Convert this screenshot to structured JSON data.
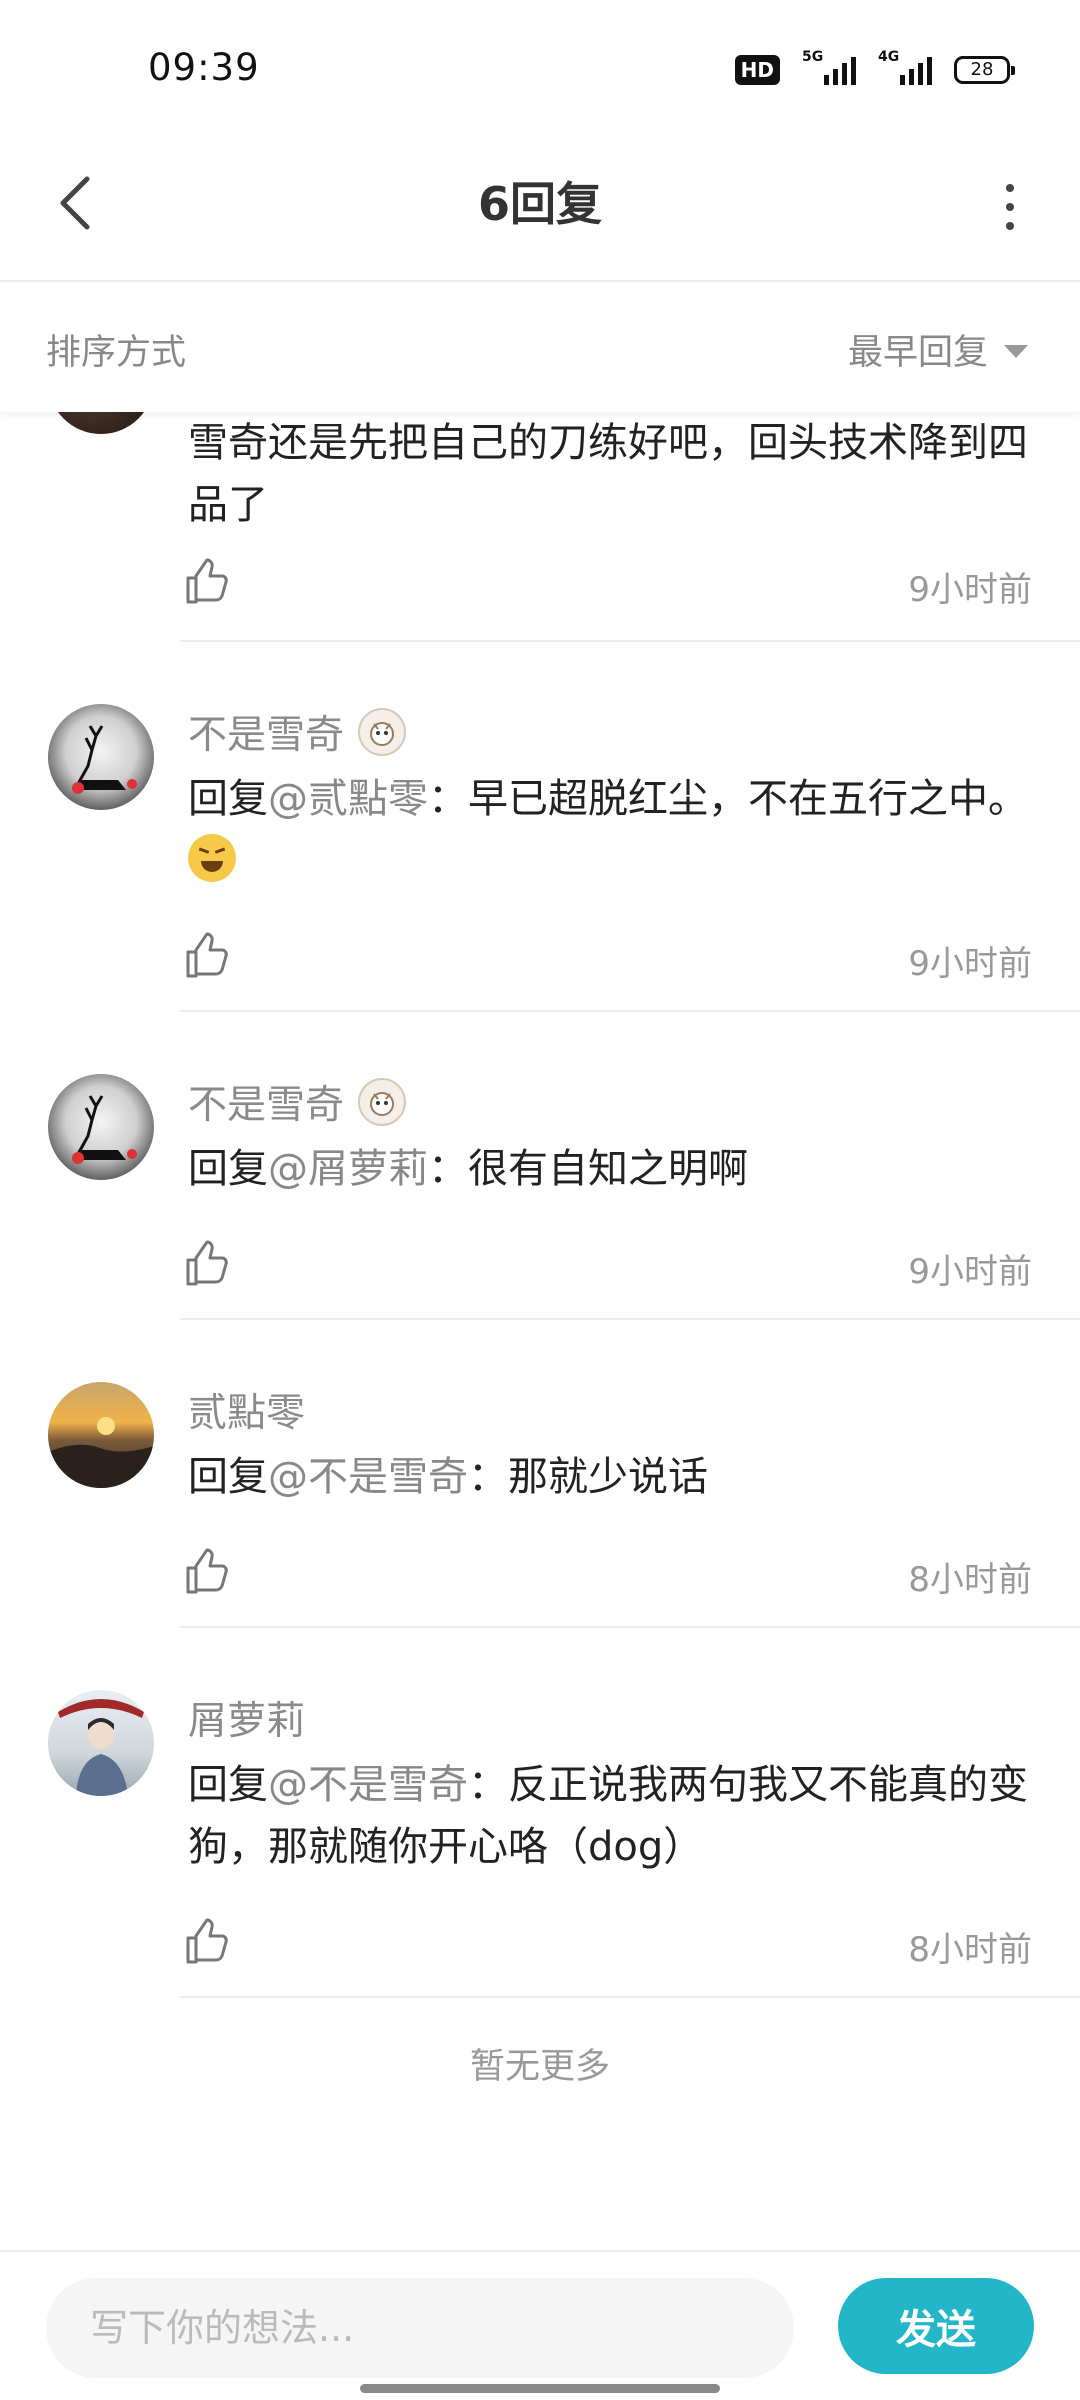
{
  "status_bar": {
    "time": "09:39",
    "hd_label": "HD",
    "network_5g": "5G",
    "network_4g": "4G",
    "battery": "28"
  },
  "header": {
    "title": "6回复"
  },
  "sort": {
    "label": "排序方式",
    "selected": "最早回复"
  },
  "replies": [
    {
      "username": "",
      "prefix": "",
      "mention": "",
      "text": "雪奇还是先把自己的刀练好吧，回头技术降到四品了",
      "time": "9小时前"
    },
    {
      "username": "不是雪奇",
      "prefix": "回复",
      "mention": "@贰點零",
      "text": "：早已超脱红尘，不在五行之中。",
      "emoji": "laughing-emoji",
      "time": "9小时前"
    },
    {
      "username": "不是雪奇",
      "prefix": "回复",
      "mention": "@屑萝莉",
      "text": "：很有自知之明啊",
      "time": "9小时前"
    },
    {
      "username": "贰點零",
      "prefix": "回复",
      "mention": "@不是雪奇",
      "text": "：那就少说话",
      "time": "8小时前"
    },
    {
      "username": "屑萝莉",
      "prefix": "回复",
      "mention": "@不是雪奇",
      "text": "：反正说我两句我又不能真的变狗，那就随你开心咯（dog）",
      "time": "8小时前"
    }
  ],
  "footer_text": "暂无更多",
  "input": {
    "placeholder": "写下你的想法...",
    "value": ""
  },
  "send_label": "发送",
  "colors": {
    "accent": "#22b6c8",
    "muted_text": "#999999",
    "username": "#8a8a8a"
  }
}
